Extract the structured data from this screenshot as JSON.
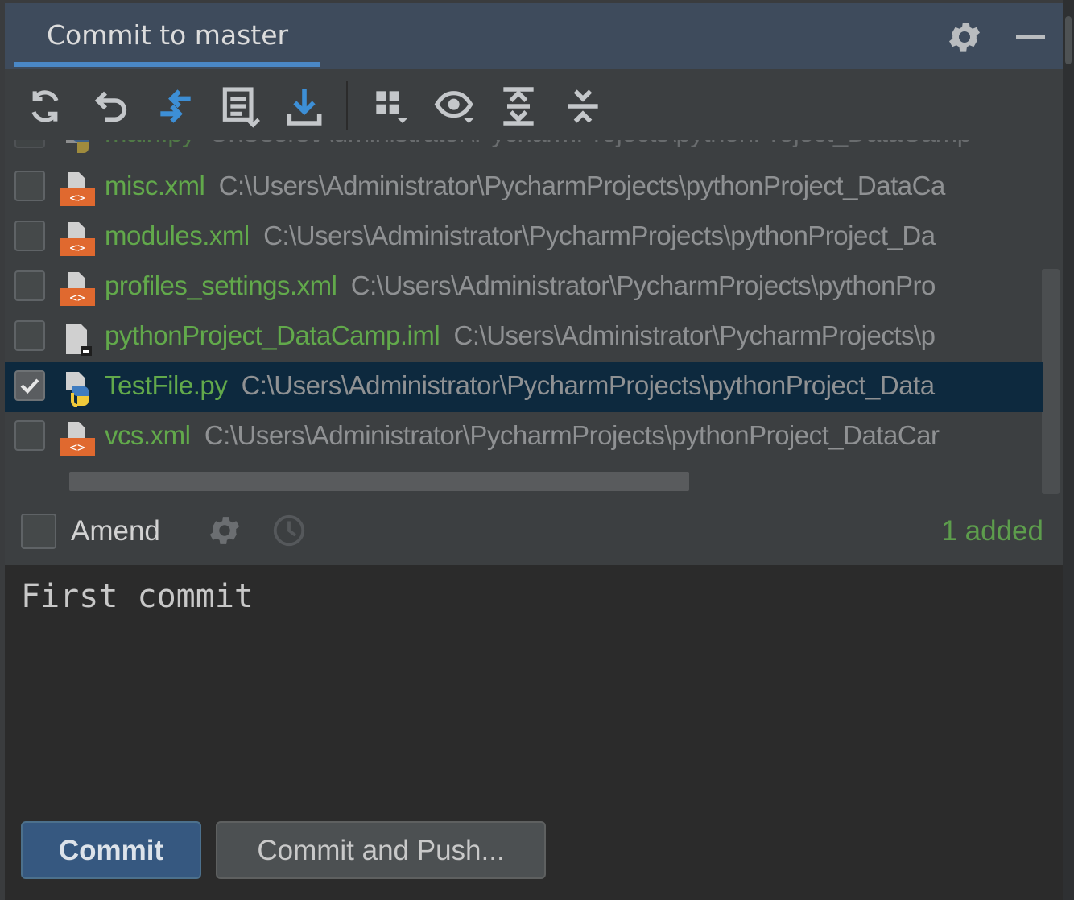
{
  "header": {
    "tab_title": "Commit to master",
    "settings_icon": "gear-icon",
    "minimize_icon": "minimize-icon"
  },
  "toolbar": {
    "buttons": [
      {
        "name": "refresh",
        "icon": "refresh-icon"
      },
      {
        "name": "rollback",
        "icon": "rollback-icon"
      },
      {
        "name": "show-diff",
        "icon": "diff-arrows-icon"
      },
      {
        "name": "changelist",
        "icon": "changelist-icon"
      },
      {
        "name": "update",
        "icon": "download-icon"
      },
      {
        "name": "group-by",
        "icon": "group-by-icon"
      },
      {
        "name": "view-options",
        "icon": "eye-icon"
      },
      {
        "name": "expand-all",
        "icon": "expand-all-icon"
      },
      {
        "name": "collapse-all",
        "icon": "collapse-all-icon"
      }
    ]
  },
  "files": [
    {
      "name": "main.py",
      "path": "C:\\Users\\Administrator\\PycharmProjects\\pythonProject_DataCamp",
      "checked": false,
      "type": "python",
      "partial": true
    },
    {
      "name": "misc.xml",
      "path": "C:\\Users\\Administrator\\PycharmProjects\\pythonProject_DataCa",
      "checked": false,
      "type": "xml"
    },
    {
      "name": "modules.xml",
      "path": "C:\\Users\\Administrator\\PycharmProjects\\pythonProject_Da",
      "checked": false,
      "type": "xml"
    },
    {
      "name": "profiles_settings.xml",
      "path": "C:\\Users\\Administrator\\PycharmProjects\\pythonPro",
      "checked": false,
      "type": "xml"
    },
    {
      "name": "pythonProject_DataCamp.iml",
      "path": "C:\\Users\\Administrator\\PycharmProjects\\p",
      "checked": false,
      "type": "iml"
    },
    {
      "name": "TestFile.py",
      "path": "C:\\Users\\Administrator\\PycharmProjects\\pythonProject_Data",
      "checked": true,
      "type": "python",
      "selected": true
    },
    {
      "name": "vcs.xml",
      "path": "C:\\Users\\Administrator\\PycharmProjects\\pythonProject_DataCar",
      "checked": false,
      "type": "xml"
    }
  ],
  "amend": {
    "label": "Amend",
    "checked": false,
    "status": "1 added"
  },
  "message": {
    "text": "First commit"
  },
  "buttons": {
    "commit": "Commit",
    "commit_and_push": "Commit and Push..."
  },
  "colors": {
    "accent": "#4a88c7",
    "added_green": "#62a94b",
    "selection": "#0d293e",
    "commit_button": "#365880"
  }
}
